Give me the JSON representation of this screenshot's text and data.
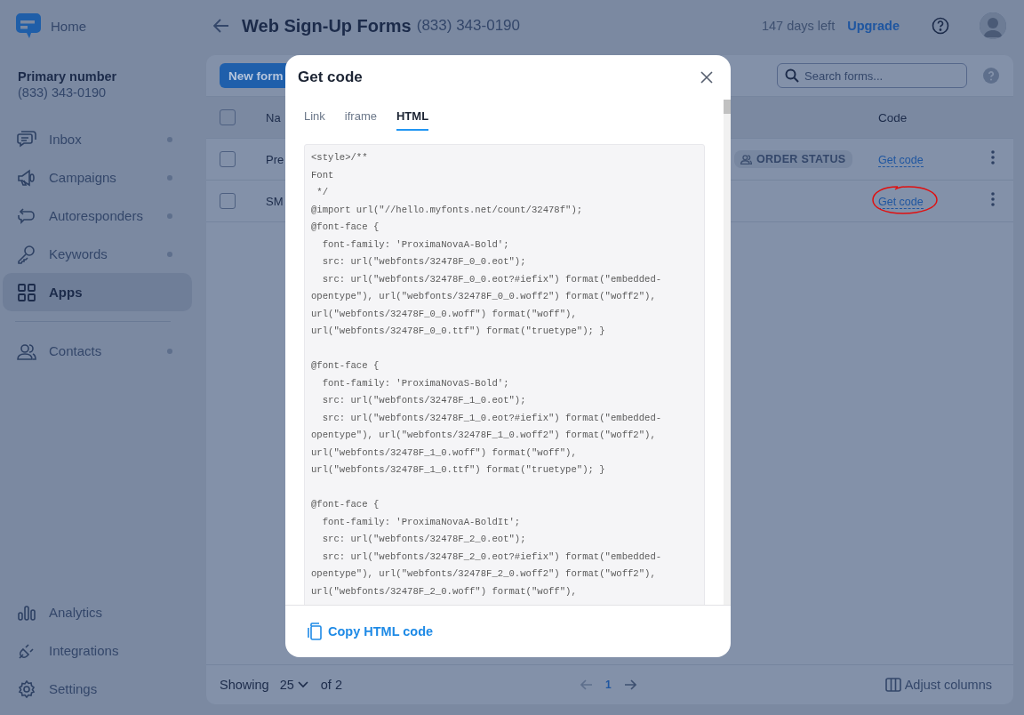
{
  "sidebar": {
    "home": "Home",
    "primary_number": {
      "label": "Primary number",
      "value": "(833) 343-0190"
    },
    "nav_items": [
      {
        "label": "Inbox",
        "selected": false,
        "dot": true
      },
      {
        "label": "Campaigns",
        "selected": false,
        "dot": true
      },
      {
        "label": "Autoresponders",
        "selected": false,
        "dot": true
      },
      {
        "label": "Keywords",
        "selected": false,
        "dot": true
      },
      {
        "label": "Apps",
        "selected": true,
        "dot": false
      },
      {
        "label": "Contacts",
        "selected": false,
        "dot": true
      }
    ],
    "bottom_items": [
      {
        "label": "Analytics"
      },
      {
        "label": "Integrations"
      },
      {
        "label": "Settings"
      }
    ]
  },
  "header": {
    "title": "Web Sign-Up Forms",
    "phone": "(833) 343-0190",
    "trial": "147 days left",
    "upgrade": "Upgrade"
  },
  "toolbar": {
    "new_button": "New form",
    "search": {
      "placeholder": "Search forms..."
    }
  },
  "table": {
    "select_all": {
      "checked": false
    },
    "columns": [
      {
        "label": "Na"
      },
      {
        "label": "Code"
      }
    ],
    "rows": [
      {
        "name": "Pre",
        "tag": "ORDER STATUS",
        "code_link": "Get code",
        "checked": false,
        "circled": false
      },
      {
        "name": "SM",
        "code_link": "Get code",
        "checked": false,
        "circled": true
      }
    ]
  },
  "footer": {
    "showing": "Showing",
    "page_size": "25",
    "of": "of 2",
    "page": "1",
    "adjust": "Adjust columns"
  },
  "modal": {
    "title": "Get code",
    "tabs": [
      {
        "label": "Link",
        "selected": false
      },
      {
        "label": "iframe",
        "selected": false
      },
      {
        "label": "HTML",
        "selected": true
      }
    ],
    "code_blocks": [
      [
        "<style>/**",
        "Font",
        " */",
        "@import url(\"//hello.myfonts.net/count/32478f\");",
        "@font-face {",
        "  font-family: 'ProximaNovaA-Bold';",
        "  src: url(\"webfonts/32478F_0_0.eot\");",
        "  src: url(\"webfonts/32478F_0_0.eot?#iefix\") format(\"embedded-",
        "opentype\"), url(\"webfonts/32478F_0_0.woff2\") format(\"woff2\"),",
        "url(\"webfonts/32478F_0_0.woff\") format(\"woff\"),",
        "url(\"webfonts/32478F_0_0.ttf\") format(\"truetype\"); }"
      ],
      [
        "@font-face {",
        "  font-family: 'ProximaNovaS-Bold';",
        "  src: url(\"webfonts/32478F_1_0.eot\");",
        "  src: url(\"webfonts/32478F_1_0.eot?#iefix\") format(\"embedded-",
        "opentype\"), url(\"webfonts/32478F_1_0.woff2\") format(\"woff2\"),",
        "url(\"webfonts/32478F_1_0.woff\") format(\"woff\"),",
        "url(\"webfonts/32478F_1_0.ttf\") format(\"truetype\"); }"
      ],
      [
        "@font-face {",
        "  font-family: 'ProximaNovaA-BoldIt';",
        "  src: url(\"webfonts/32478F_2_0.eot\");",
        "  src: url(\"webfonts/32478F_2_0.eot?#iefix\") format(\"embedded-",
        "opentype\"), url(\"webfonts/32478F_2_0.woff2\") format(\"woff2\"),",
        "url(\"webfonts/32478F_2_0.woff\") format(\"woff\"),"
      ]
    ],
    "copy_button": "Copy HTML code"
  }
}
